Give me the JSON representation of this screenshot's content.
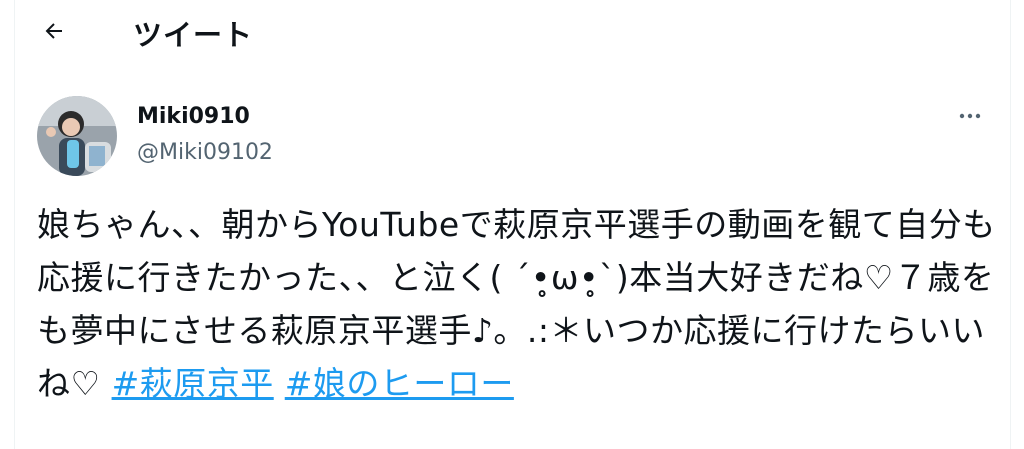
{
  "header": {
    "title": "ツイート",
    "back_icon": "arrow-left-icon"
  },
  "author": {
    "display_name": "Miki0910",
    "handle": "@Miki09102",
    "more_icon": "more-horizontal-icon"
  },
  "tweet": {
    "text": "娘ちゃん、、朝からYouTubeで萩原京平選手の動画を観て自分も応援に行きたかった、、と泣く( ´•̥ω•̥`)本当大好きだね♡７歳をも夢中にさせる萩原京平選手♪。.:＊いつか応援に行けたらいいね♡ ",
    "hashtags": [
      "#萩原京平",
      "#娘のヒーロー"
    ]
  },
  "colors": {
    "link": "#1d9bf0",
    "text": "#0f1419",
    "secondary": "#536471"
  }
}
